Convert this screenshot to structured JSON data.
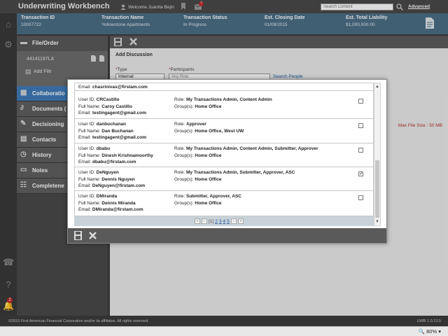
{
  "app": {
    "title": "Underwriting Workbench"
  },
  "header": {
    "welcome": "Welcome Juanita Bejin",
    "notification_count": "7",
    "search_placeholder": "Search Content",
    "advanced_label": "Advanced"
  },
  "rail": {
    "badge_count": "2"
  },
  "transaction": {
    "columns": [
      {
        "label": "Transaction ID",
        "value": "10007722"
      },
      {
        "label": "Transaction Name",
        "value": "Yellowstone Apartments"
      },
      {
        "label": "Transaction Status",
        "value": "In Progress"
      },
      {
        "label": "Est. Closing Date",
        "value": "01/09/2015"
      },
      {
        "label": "Est. Total Liability",
        "value": "$1,000,000.00"
      }
    ]
  },
  "sidebar": {
    "file_order_label": "File/Order",
    "order_number": "44141197LA",
    "add_file_label": "Add File",
    "items": [
      {
        "label": "Collaboratio"
      },
      {
        "label": "Documents ("
      },
      {
        "label": "Decisioning"
      },
      {
        "label": "Contacts"
      },
      {
        "label": "History"
      },
      {
        "label": "Notes"
      },
      {
        "label": "Completene"
      }
    ]
  },
  "main": {
    "section_title": "Add Discussion",
    "type_label": "Type",
    "type_value": "Internal",
    "participants_label": "Participants",
    "participants_placeholder": "Any Role",
    "search_people_label": "Search People",
    "max_file_size": "Max File Size : 50 MB"
  },
  "modal": {
    "partial_top_email": "chasrinivas@firstam.com",
    "labels": {
      "user_id": "User ID:",
      "full_name": "Full Name:",
      "email": "Email:",
      "role": "Role:",
      "groups": "Group(s):"
    },
    "users": [
      {
        "user_id": "CRCastillo",
        "full_name": "Caroy Castillo",
        "email": "testingagent@gmail.com",
        "role": "My Transactions Admin, Content Admin",
        "groups": "Home Office",
        "checked": false
      },
      {
        "user_id": "danbuchanan",
        "full_name": "Dan Buchanan",
        "email": "testingagent@gmail.com",
        "role": "Approver",
        "groups": "Home Office, West UW",
        "checked": false
      },
      {
        "user_id": "dbabu",
        "full_name": "Dinesh Krishnamoorthy",
        "email": "dbabu@firstam.com",
        "role": "My Transactions Admin, Content Admin, Submitter, Approver",
        "groups": "Home Office",
        "checked": false
      },
      {
        "user_id": "DeNguyen",
        "full_name": "Dennis Nguyen",
        "email": "DeNguyen@firstam.com",
        "role": "My Transactions Admin, Submitter, Approver, ASC",
        "groups": "Home Office",
        "checked": true
      },
      {
        "user_id": "DMiranda",
        "full_name": "Dennis Miranda",
        "email": "DMiranda@firstam.com",
        "role": "Submitter, Approver, ASC",
        "groups": "Home Office",
        "checked": false
      }
    ],
    "pager": {
      "current": "[1]",
      "pages": [
        "2",
        "3",
        "4",
        "5"
      ]
    }
  },
  "footer": {
    "copyright": "©2015 First American Financial Corporation and/or its affiliates. All rights reserved.",
    "version": "UWB 1.0.13.5"
  },
  "statusbar": {
    "zoom": "80%"
  }
}
